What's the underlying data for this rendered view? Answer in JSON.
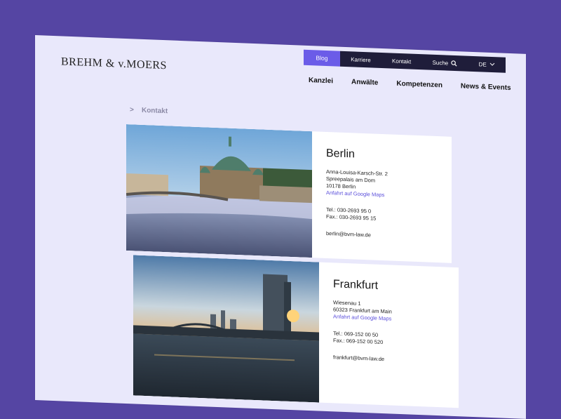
{
  "header": {
    "logo": "BREHM & v.MOERS",
    "top_links": [
      "Blog",
      "Karriere",
      "Kontakt",
      "Suche",
      "DE"
    ],
    "main_nav": [
      "Kanzlei",
      "Anwälte",
      "Kompetenzen",
      "News & Events"
    ]
  },
  "breadcrumb": {
    "separator": ">",
    "current": "Kontakt"
  },
  "locations": [
    {
      "city": "Berlin",
      "address": [
        "Anna-Louisa-Karsch-Str. 2",
        "Spreepalais am Dom",
        "10178 Berlin"
      ],
      "maps": "Anfahrt auf Google Maps",
      "tel": "Tel.: 030-2693 95 0",
      "fax": "Fax.: 030-2693 95 15",
      "email": "berlin@bvm-law.de"
    },
    {
      "city": "Frankfurt",
      "address": [
        "Wiesenau 1",
        "60323 Frankfurt am Main"
      ],
      "maps": "Anfahrt auf Google Maps",
      "tel": "Tel.: 069-152 00 50",
      "fax": "Fax.: 069-152 00 520",
      "email": "frankfurt@bvm-law.de"
    }
  ],
  "colors": {
    "background": "#5545a3",
    "page": "#e9e8fb",
    "accent": "#6b5ce8",
    "topbar": "#1f1d3a"
  },
  "icons": [
    "search-icon",
    "chevron-down-icon"
  ]
}
